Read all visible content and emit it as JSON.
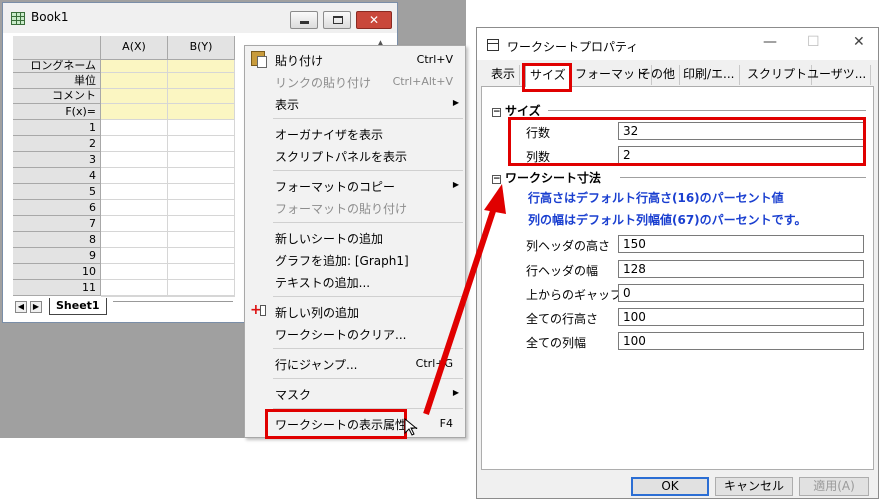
{
  "book": {
    "title": "Book1",
    "columns": [
      "A(X)",
      "B(Y)"
    ],
    "meta_rows": [
      "ロングネーム",
      "単位",
      "コメント",
      "F(x)="
    ],
    "rows": [
      "1",
      "2",
      "3",
      "4",
      "5",
      "6",
      "7",
      "8",
      "9",
      "10",
      "11"
    ],
    "sheet_tab": "Sheet1",
    "close_glyph": "✕"
  },
  "menu": {
    "items": [
      {
        "label": "貼り付け",
        "shortcut": "Ctrl+V"
      },
      {
        "label": "リンクの貼り付け",
        "shortcut": "Ctrl+Alt+V"
      },
      {
        "label": "表示"
      },
      {
        "label": "オーガナイザを表示"
      },
      {
        "label": "スクリプトパネルを表示"
      },
      {
        "label": "フォーマットのコピー"
      },
      {
        "label": "フォーマットの貼り付け"
      },
      {
        "label": "新しいシートの追加"
      },
      {
        "label": "グラフを追加: [Graph1]"
      },
      {
        "label": "テキストの追加..."
      },
      {
        "label": "新しい列の追加"
      },
      {
        "label": "ワークシートのクリア..."
      },
      {
        "label": "行にジャンプ...",
        "shortcut": "Ctrl+G"
      },
      {
        "label": "マスク"
      },
      {
        "label": "ワークシートの表示属性...",
        "shortcut": "F4"
      }
    ]
  },
  "dialog": {
    "title": "ワークシートプロパティ",
    "tabs": [
      "表示",
      "サイズ",
      "フォーマット",
      "その他",
      "印刷/エ...",
      "スクリプト",
      "ユーザツ..."
    ],
    "size_section": "サイズ",
    "rows_label": "行数",
    "rows_value": "32",
    "cols_label": "列数",
    "cols_value": "2",
    "dim_section": "ワークシート寸法",
    "note1": "行高さはデフォルト行高さ(16)のパーセント値",
    "note2": "列の幅はデフォルト列幅値(67)のパーセントです。",
    "fields": [
      {
        "label": "列ヘッダの高さ",
        "value": "150"
      },
      {
        "label": "行ヘッダの幅",
        "value": "128"
      },
      {
        "label": "上からのギャップ",
        "value": "0"
      },
      {
        "label": "全ての行高さ",
        "value": "100"
      },
      {
        "label": "全ての列幅",
        "value": "100"
      }
    ],
    "ok": "OK",
    "cancel": "キャンセル",
    "apply": "適用(A)",
    "collapse_glyph": "−",
    "close_glyph": "✕",
    "max_glyph": "☐",
    "min_glyph": "—"
  },
  "colors": {
    "highlight": "#e00000",
    "note": "#1a3fd0",
    "meta_cells": "#fbf6c2"
  }
}
